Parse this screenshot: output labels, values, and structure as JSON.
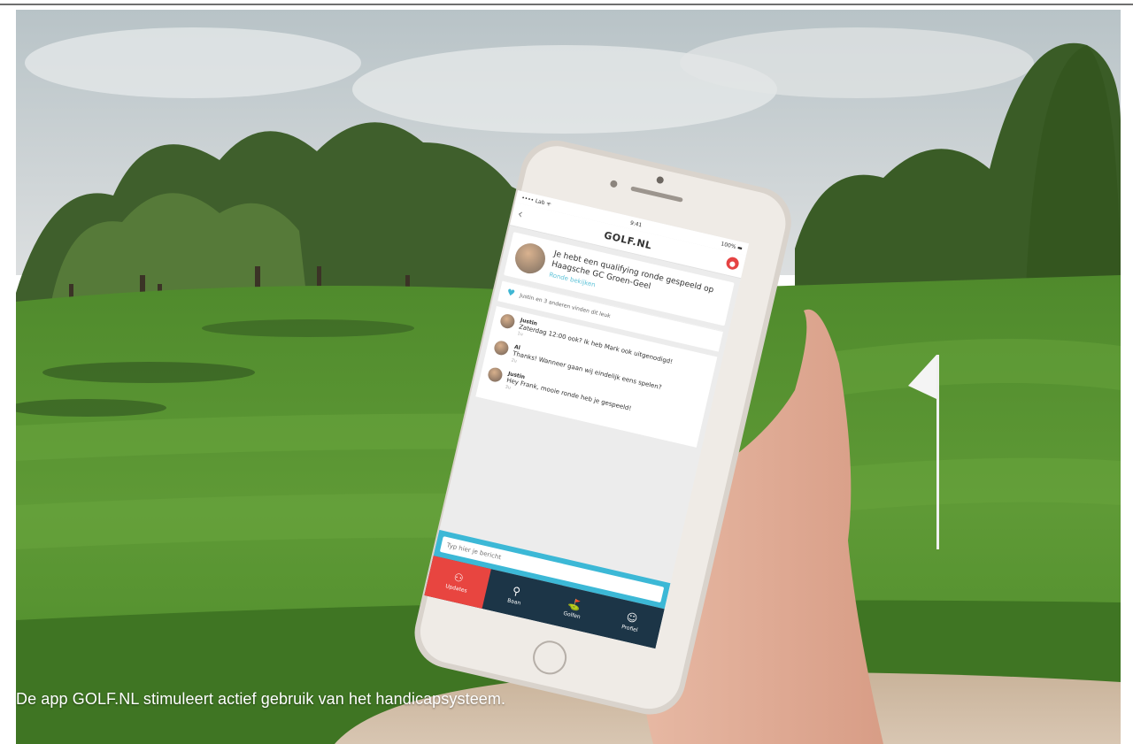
{
  "caption": "De app GOLF.NL stimuleert actief gebruik van het handicapsysteem.",
  "phone": {
    "status": {
      "carrier": "•••• Lab ᯤ",
      "time": "9:41",
      "battery": "100% ▬"
    },
    "app_logo": "GOLF.NL",
    "qualifying_text": "Je hebt een qualifying ronde gespeeld op Haagsche GC Groen-Geel",
    "qualifying_link": "Ronde bekijken",
    "like_text": "Justin en 3 anderen vinden dit leuk",
    "comments": [
      {
        "name": "Justin",
        "text": "Zaterdag 12:00 ook? Ik heb Mark ook uitgenodigd!",
        "time": "1u"
      },
      {
        "name": "Al",
        "text": "Thanks! Wanneer gaan wij eindelijk eens spelen?",
        "time": "2u"
      },
      {
        "name": "Justin",
        "text": "Hey Frank, mooie ronde heb je gespeeld!",
        "time": "3u"
      }
    ],
    "input_placeholder": "Typ hier je bericht",
    "tabs": [
      {
        "label": "Updates",
        "icon": "users-icon"
      },
      {
        "label": "Baan",
        "icon": "map-pin-icon"
      },
      {
        "label": "Golfen",
        "icon": "golfer-icon"
      },
      {
        "label": "Profiel",
        "icon": "user-icon"
      }
    ]
  },
  "colors": {
    "accent_red": "#e84540",
    "accent_blue": "#3cb8d6",
    "tabbar_navy": "#1c3547"
  }
}
